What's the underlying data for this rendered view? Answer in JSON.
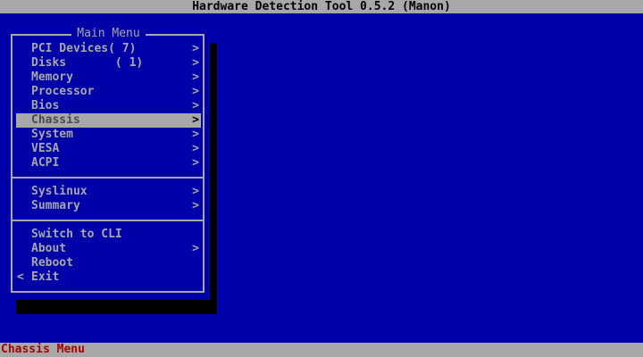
{
  "title": "Hardware Detection Tool 0.5.2 (Manon)",
  "status": "Chassis Menu",
  "menu": {
    "title": "Main Menu",
    "groups": [
      [
        {
          "label": "PCI Devices( 7)",
          "arrow": ">"
        },
        {
          "label": "Disks       ( 1)",
          "arrow": ">"
        },
        {
          "label": "Memory",
          "arrow": ">"
        },
        {
          "label": "Processor",
          "arrow": ">"
        },
        {
          "label": "Bios",
          "arrow": ">"
        },
        {
          "label": "Chassis",
          "arrow": ">",
          "selected": true
        },
        {
          "label": "System",
          "arrow": ">"
        },
        {
          "label": "VESA",
          "arrow": ">"
        },
        {
          "label": "ACPI",
          "arrow": ">"
        }
      ],
      [
        {
          "label": "Syslinux",
          "arrow": ">"
        },
        {
          "label": "Summary",
          "arrow": ">"
        }
      ],
      [
        {
          "label": "Switch to CLI",
          "arrow": ""
        },
        {
          "label": "About",
          "arrow": ">"
        },
        {
          "label": "Reboot",
          "arrow": ""
        },
        {
          "label": "Exit",
          "arrow": "",
          "back_arrow": "<"
        }
      ]
    ]
  },
  "colors": {
    "background": "#0000a8",
    "bar": "#a8a8a8",
    "status_text": "#a80000",
    "text": "#a8a8a8",
    "shadow": "#000000"
  }
}
